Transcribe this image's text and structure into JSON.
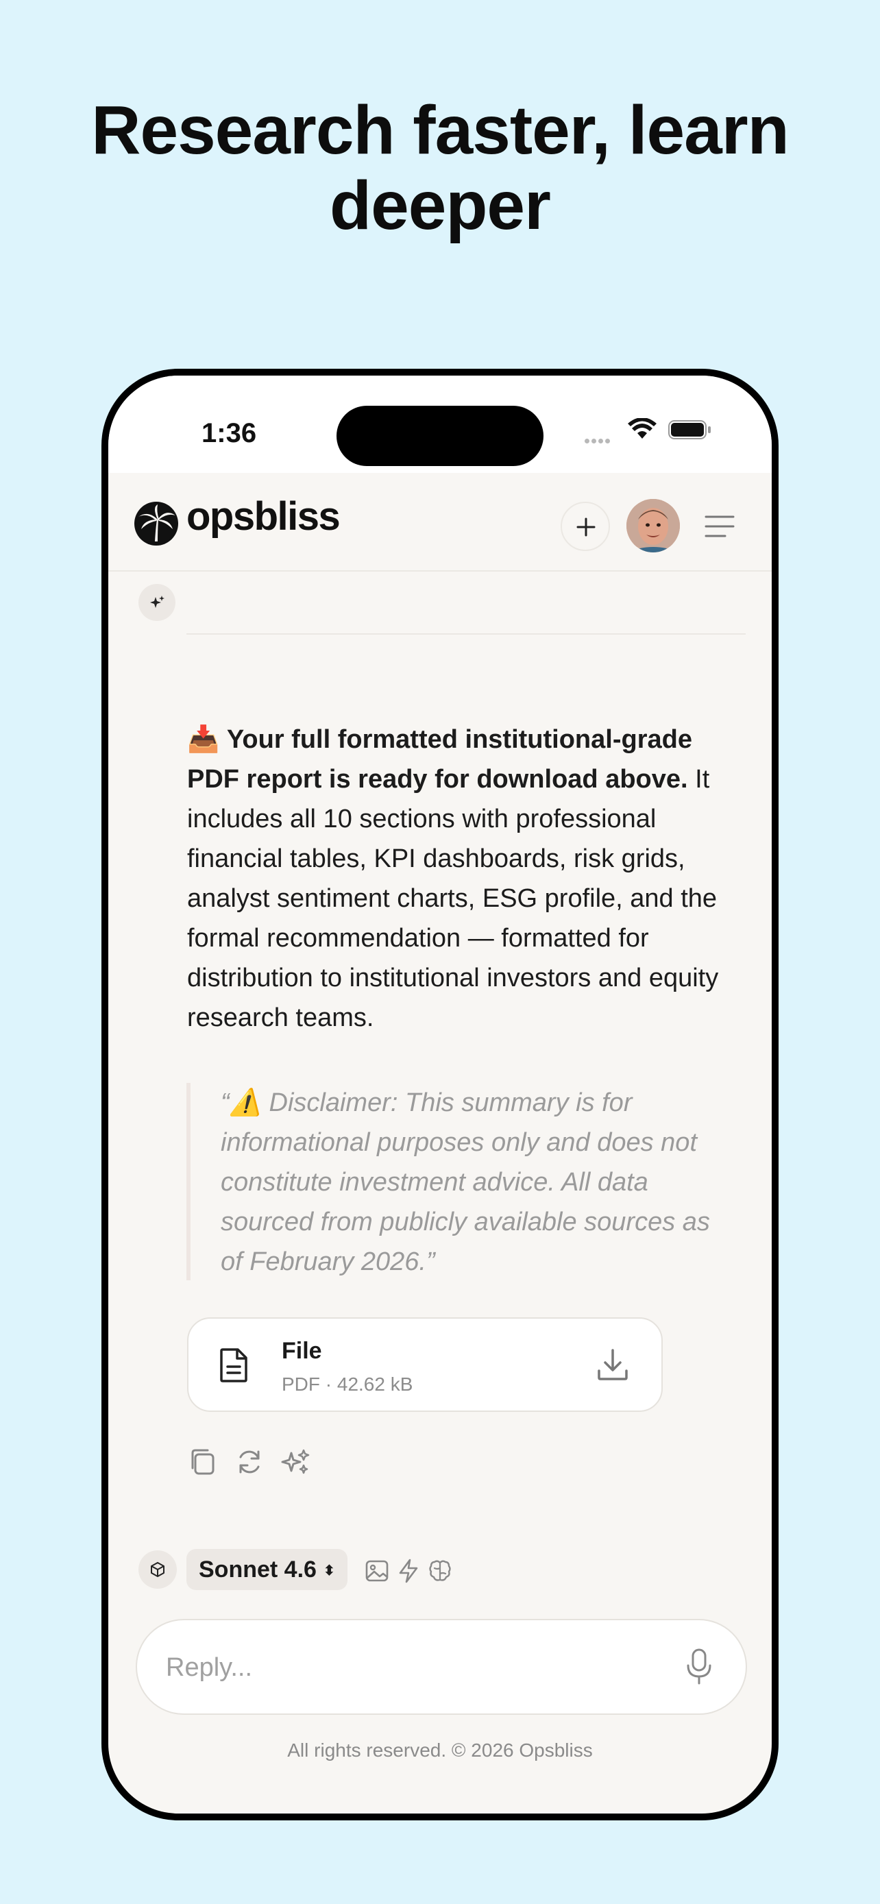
{
  "headline": "Research faster, learn deeper",
  "status_bar": {
    "time": "1:36"
  },
  "header": {
    "logo_text": "opsbliss"
  },
  "message": {
    "emoji": "📥",
    "bold": "Your full formatted institutional-grade PDF report is ready for download above.",
    "body": " It includes all 10 sections with professional financial tables, KPI dashboards, risk grids, analyst sentiment charts, ESG profile, and the formal recommendation — formatted for distribution to institutional investors and equity research teams.",
    "quote": "“⚠️ Disclaimer: This summary is for informational purposes only and does not constitute investment advice. All data sourced from publicly available sources as of February 2026.”"
  },
  "file": {
    "name": "File",
    "meta": "PDF · 42.62 kB"
  },
  "composer": {
    "model": "Sonnet 4.6",
    "placeholder": "Reply..."
  },
  "footer": "All rights reserved. © 2026 Opsbliss",
  "colors": {
    "background": "#ddf4fc",
    "screen": "#f8f6f3",
    "text": "#1c1c1c",
    "muted": "#9a9a9a"
  },
  "icons": [
    "wifi-icon",
    "battery-icon",
    "palm-logo-icon",
    "plus-icon",
    "avatar",
    "menu-icon",
    "sparkle-icon",
    "document-icon",
    "download-icon",
    "copy-icon",
    "retry-icon",
    "sparkles-icon",
    "cube-icon",
    "image-icon",
    "bolt-icon",
    "brain-icon",
    "mic-icon"
  ]
}
